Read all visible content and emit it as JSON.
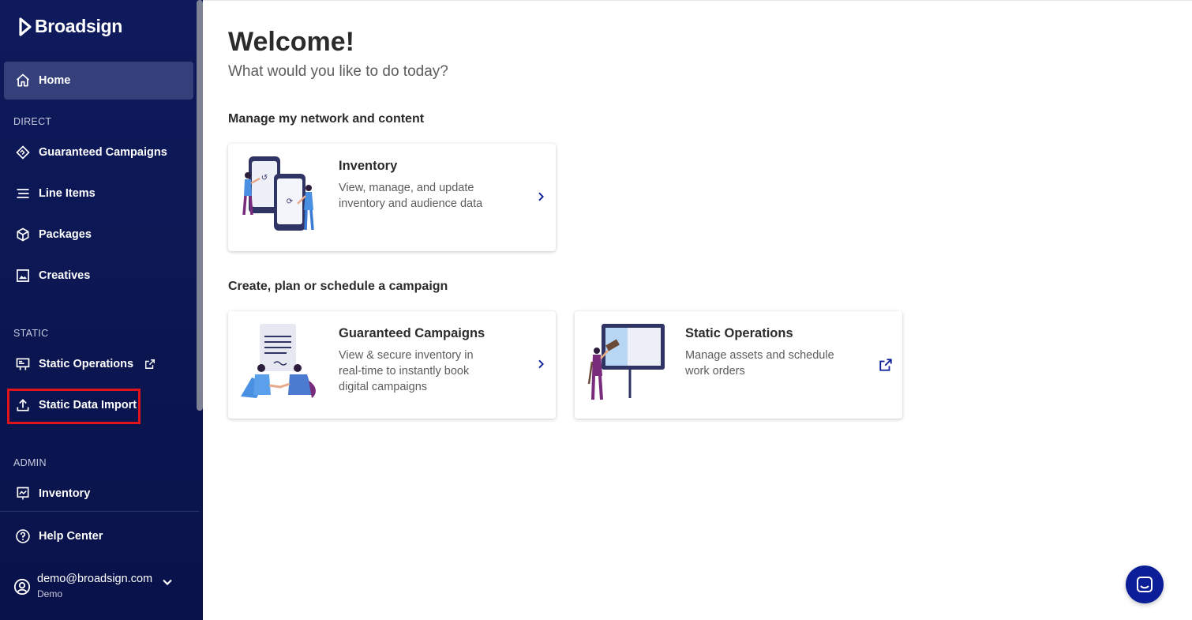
{
  "brand": {
    "name": "Broadsign"
  },
  "sidebar": {
    "home": {
      "label": "Home",
      "icon": "home-icon"
    },
    "sections": {
      "direct": "DIRECT",
      "static": "STATIC",
      "admin": "ADMIN"
    },
    "direct_items": [
      {
        "label": "Guaranteed Campaigns",
        "icon": "handshake-icon"
      },
      {
        "label": "Line Items",
        "icon": "lines-icon"
      },
      {
        "label": "Packages",
        "icon": "package-icon"
      },
      {
        "label": "Creatives",
        "icon": "image-icon"
      }
    ],
    "static_items": [
      {
        "label": "Static Operations",
        "icon": "billboard-icon"
      },
      {
        "label": "Static Data Import",
        "icon": "upload-icon"
      }
    ],
    "admin_items": [
      {
        "label": "Inventory",
        "icon": "screen-icon"
      }
    ],
    "help": {
      "label": "Help Center",
      "icon": "help-icon"
    },
    "user": {
      "email": "demo@broadsign.com",
      "org": "Demo"
    }
  },
  "main": {
    "title": "Welcome!",
    "subtitle": "What would you like to do today?",
    "section1": "Manage my network and content",
    "section2": "Create, plan or schedule a campaign",
    "cards": [
      {
        "title": "Inventory",
        "description": "View, manage, and update inventory and audience data"
      },
      {
        "title": "Guaranteed Campaigns",
        "description": "View & secure inventory in real-time to instantly book digital campaigns"
      },
      {
        "title": "Static Operations",
        "description": "Manage assets and schedule work orders"
      }
    ]
  },
  "colors": {
    "sidebar_bg": "#0e1a5c",
    "active_item": "#35407a",
    "accent": "#0b1d97",
    "highlight_box": "#e0141b"
  }
}
